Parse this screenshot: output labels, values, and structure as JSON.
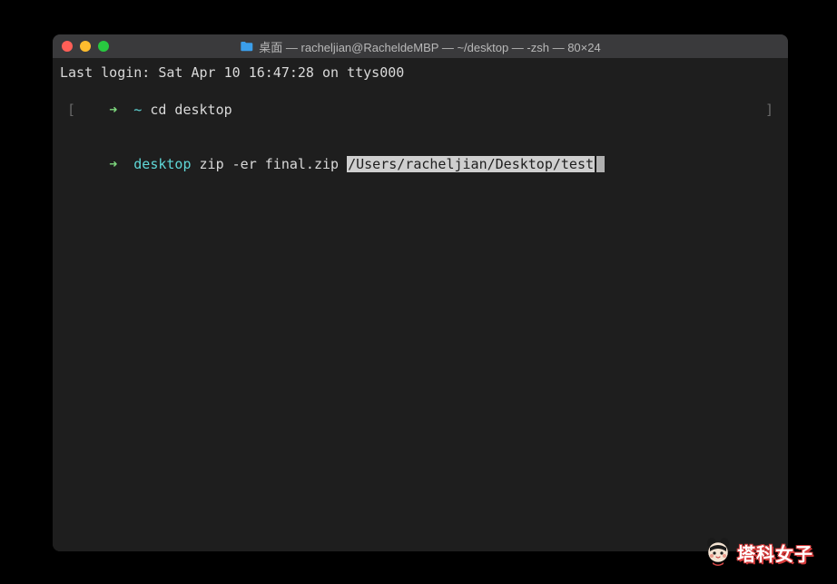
{
  "window": {
    "title": "桌面 — racheljian@RacheldeMBP — ~/desktop — -zsh — 80×24"
  },
  "terminal": {
    "last_login": "Last login: Sat Apr 10 16:47:28 on ttys000",
    "line1": {
      "arrow": "➜ ",
      "tilde": " ~",
      "cmd": " cd desktop"
    },
    "line2": {
      "arrow": "➜ ",
      "dir": " desktop",
      "cmd": " zip -er final.zip ",
      "path": "/Users/racheljian/Desktop/test"
    }
  },
  "watermark": {
    "text": "塔科女子"
  }
}
